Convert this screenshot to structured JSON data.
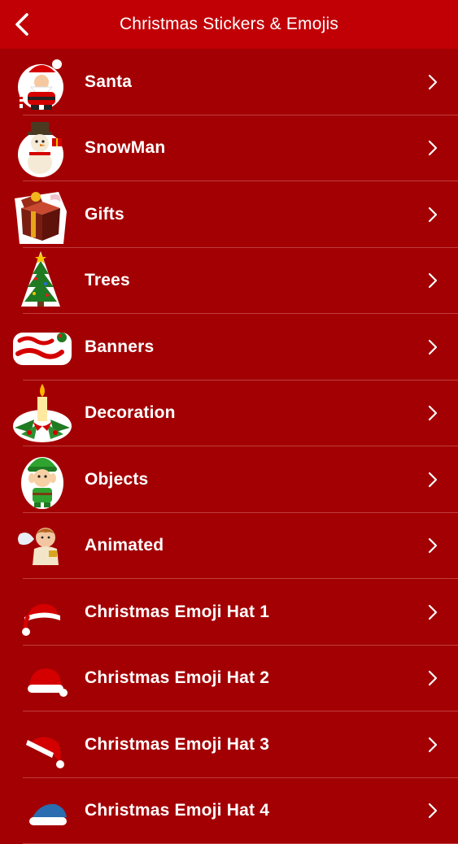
{
  "header": {
    "title": "Christmas Stickers & Emojis",
    "back_icon": "chevron-left-icon"
  },
  "categories": [
    {
      "label": "Santa",
      "icon": "santa-icon"
    },
    {
      "label": "SnowMan",
      "icon": "snowman-icon"
    },
    {
      "label": "Gifts",
      "icon": "gift-box-icon"
    },
    {
      "label": "Trees",
      "icon": "christmas-tree-icon"
    },
    {
      "label": "Banners",
      "icon": "merry-christmas-banner-icon"
    },
    {
      "label": "Decoration",
      "icon": "candle-decoration-icon"
    },
    {
      "label": "Objects",
      "icon": "elf-icon"
    },
    {
      "label": "Animated",
      "icon": "angel-icon"
    },
    {
      "label": "Christmas Emoji Hat 1",
      "icon": "santa-hat-icon"
    },
    {
      "label": "Christmas Emoji Hat 2",
      "icon": "santa-hat-icon"
    },
    {
      "label": "Christmas Emoji Hat 3",
      "icon": "santa-hat-icon"
    },
    {
      "label": "Christmas Emoji Hat 4",
      "icon": "blue-hat-icon"
    }
  ],
  "colors": {
    "header_bg": "#c10006",
    "list_bg": "#a30003",
    "text": "#ffffff",
    "separator": "#c9585a"
  }
}
